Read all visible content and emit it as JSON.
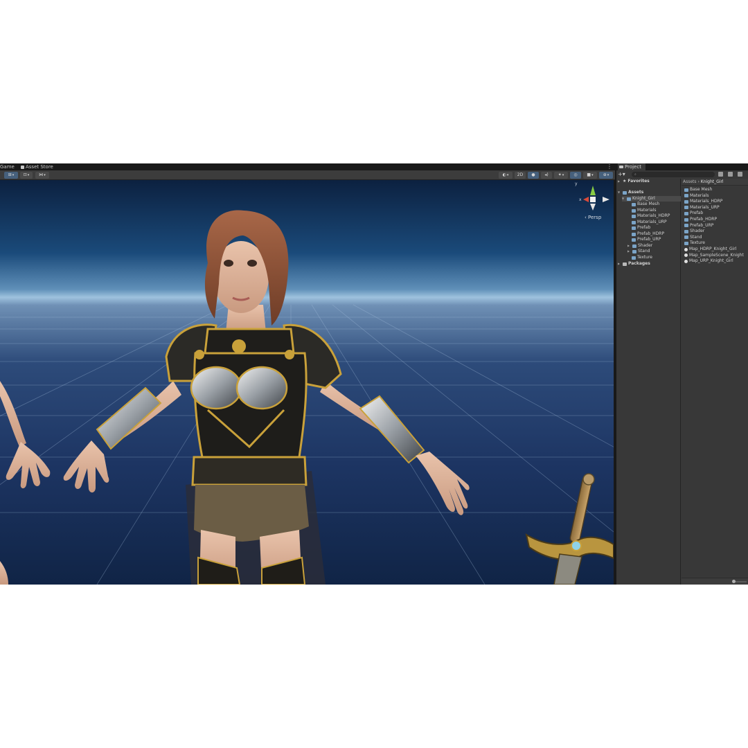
{
  "tabs": {
    "game": "Game",
    "asset_store": "Asset Store",
    "more": "⋮"
  },
  "scene_toolbar": {
    "mode_2d": "2D"
  },
  "viewport": {
    "gizmo_x": "x",
    "gizmo_y": "y",
    "projection": "‹ Persp"
  },
  "project": {
    "tab_label": "Project",
    "add_label": "+▾",
    "tree": {
      "favorites": "Favorites",
      "assets": "Assets",
      "knight_girl": "Knight_Girl",
      "children": [
        "Base Mesh",
        "Materials",
        "Materials_HDRP",
        "Materials_URP",
        "Prefab",
        "Prefab_HDRP",
        "Prefab_URP",
        "Shader",
        "Stand",
        "Texture"
      ],
      "packages": "Packages"
    },
    "breadcrumb": {
      "root": "Assets",
      "separator": "›",
      "current": "Knight_Girl"
    },
    "asset_list": [
      {
        "name": "Base Mesh",
        "icon": "folder-icon"
      },
      {
        "name": "Materials",
        "icon": "folder-icon"
      },
      {
        "name": "Materials_HDRP",
        "icon": "folder-icon"
      },
      {
        "name": "Materials_URP",
        "icon": "folder-icon"
      },
      {
        "name": "Prefab",
        "icon": "folder-icon"
      },
      {
        "name": "Prefab_HDRP",
        "icon": "folder-icon"
      },
      {
        "name": "Prefab_URP",
        "icon": "folder-icon"
      },
      {
        "name": "Shader",
        "icon": "folder-icon"
      },
      {
        "name": "Stand",
        "icon": "folder-icon"
      },
      {
        "name": "Texture",
        "icon": "folder-icon"
      },
      {
        "name": "Map_HDRP_Knight_Girl",
        "icon": "scene-icon"
      },
      {
        "name": "Map_SampleScene_Knight",
        "icon": "scene-icon"
      },
      {
        "name": "Map_URP_Knight_Girl",
        "icon": "scene-icon"
      }
    ]
  },
  "colors": {
    "panel_bg": "#383838",
    "toolbar_bg": "#3c3c3c",
    "active_button": "#46607c",
    "sky_top": "#0c2140",
    "horizon": "#9ec2de",
    "floor": "#1d3563",
    "armor_gold": "#c9a13a"
  }
}
